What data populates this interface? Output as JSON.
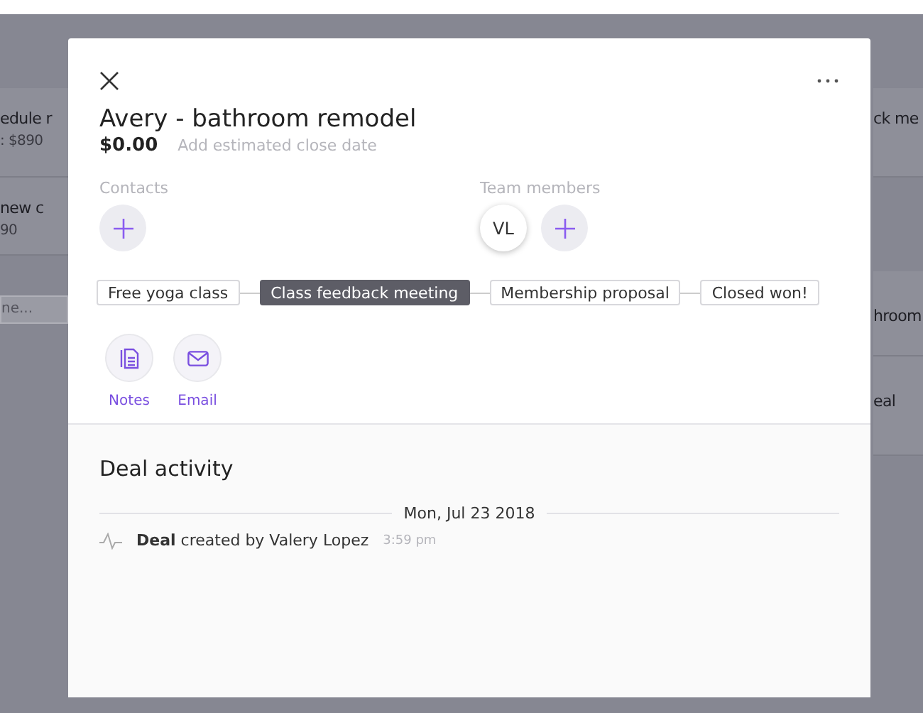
{
  "background": {
    "left_cards": [
      {
        "lines": [
          "edule r",
          ": $890"
        ]
      },
      {
        "lines": [
          "new c",
          "90"
        ]
      }
    ],
    "left_field": {
      "text": "ne..."
    },
    "right_cards": [
      {
        "text": "ck me"
      },
      {
        "text": "hroom"
      },
      {
        "text": "eal"
      }
    ]
  },
  "deal": {
    "title": "Avery - bathroom remodel",
    "amount": "$0.00",
    "close_date_placeholder": "Add estimated close date",
    "contacts": {
      "label": "Contacts"
    },
    "team": {
      "label": "Team members",
      "members": [
        "VL"
      ]
    },
    "stages": [
      {
        "label": "Free yoga class",
        "selected": false
      },
      {
        "label": "Class feedback meeting",
        "selected": true
      },
      {
        "label": "Membership proposal",
        "selected": false
      },
      {
        "label": "Closed won!",
        "selected": false
      }
    ],
    "actions": [
      {
        "kind": "notes",
        "label": "Notes"
      },
      {
        "kind": "email",
        "label": "Email"
      }
    ]
  },
  "activity": {
    "title": "Deal activity",
    "date": "Mon, Jul 23 2018",
    "entries": [
      {
        "text": "**Deal** created by Valery Lopez",
        "time": "3:59 pm"
      }
    ]
  }
}
